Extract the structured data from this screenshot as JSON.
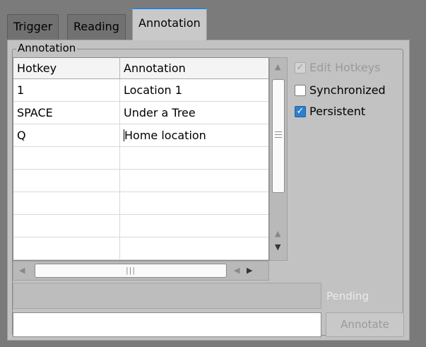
{
  "tabs": [
    {
      "label": "Trigger"
    },
    {
      "label": "Reading"
    },
    {
      "label": "Annotation",
      "active": true
    }
  ],
  "group": {
    "title": "Annotation"
  },
  "table": {
    "columns": [
      "Hotkey",
      "Annotation"
    ],
    "rows": [
      {
        "hotkey": "1",
        "annotation": "Location 1"
      },
      {
        "hotkey": "SPACE",
        "annotation": "Under a Tree"
      },
      {
        "hotkey": "Q",
        "annotation": "Home location"
      },
      {
        "hotkey": "",
        "annotation": ""
      },
      {
        "hotkey": "",
        "annotation": ""
      },
      {
        "hotkey": "",
        "annotation": ""
      },
      {
        "hotkey": "",
        "annotation": ""
      },
      {
        "hotkey": "",
        "annotation": ""
      }
    ]
  },
  "options": {
    "edit_hotkeys": {
      "label": "Edit Hotkeys",
      "checked": true,
      "enabled": false
    },
    "synchronized": {
      "label": "Synchronized",
      "checked": false,
      "enabled": true
    },
    "persistent": {
      "label": "Persistent",
      "checked": true,
      "enabled": true
    }
  },
  "pending": {
    "label": "Pending"
  },
  "annotate": {
    "input_value": "",
    "button_label": "Annotate"
  },
  "colors": {
    "accent": "#2f7fcf",
    "panel": "#c2c2c2",
    "background": "#7a7a7a"
  }
}
